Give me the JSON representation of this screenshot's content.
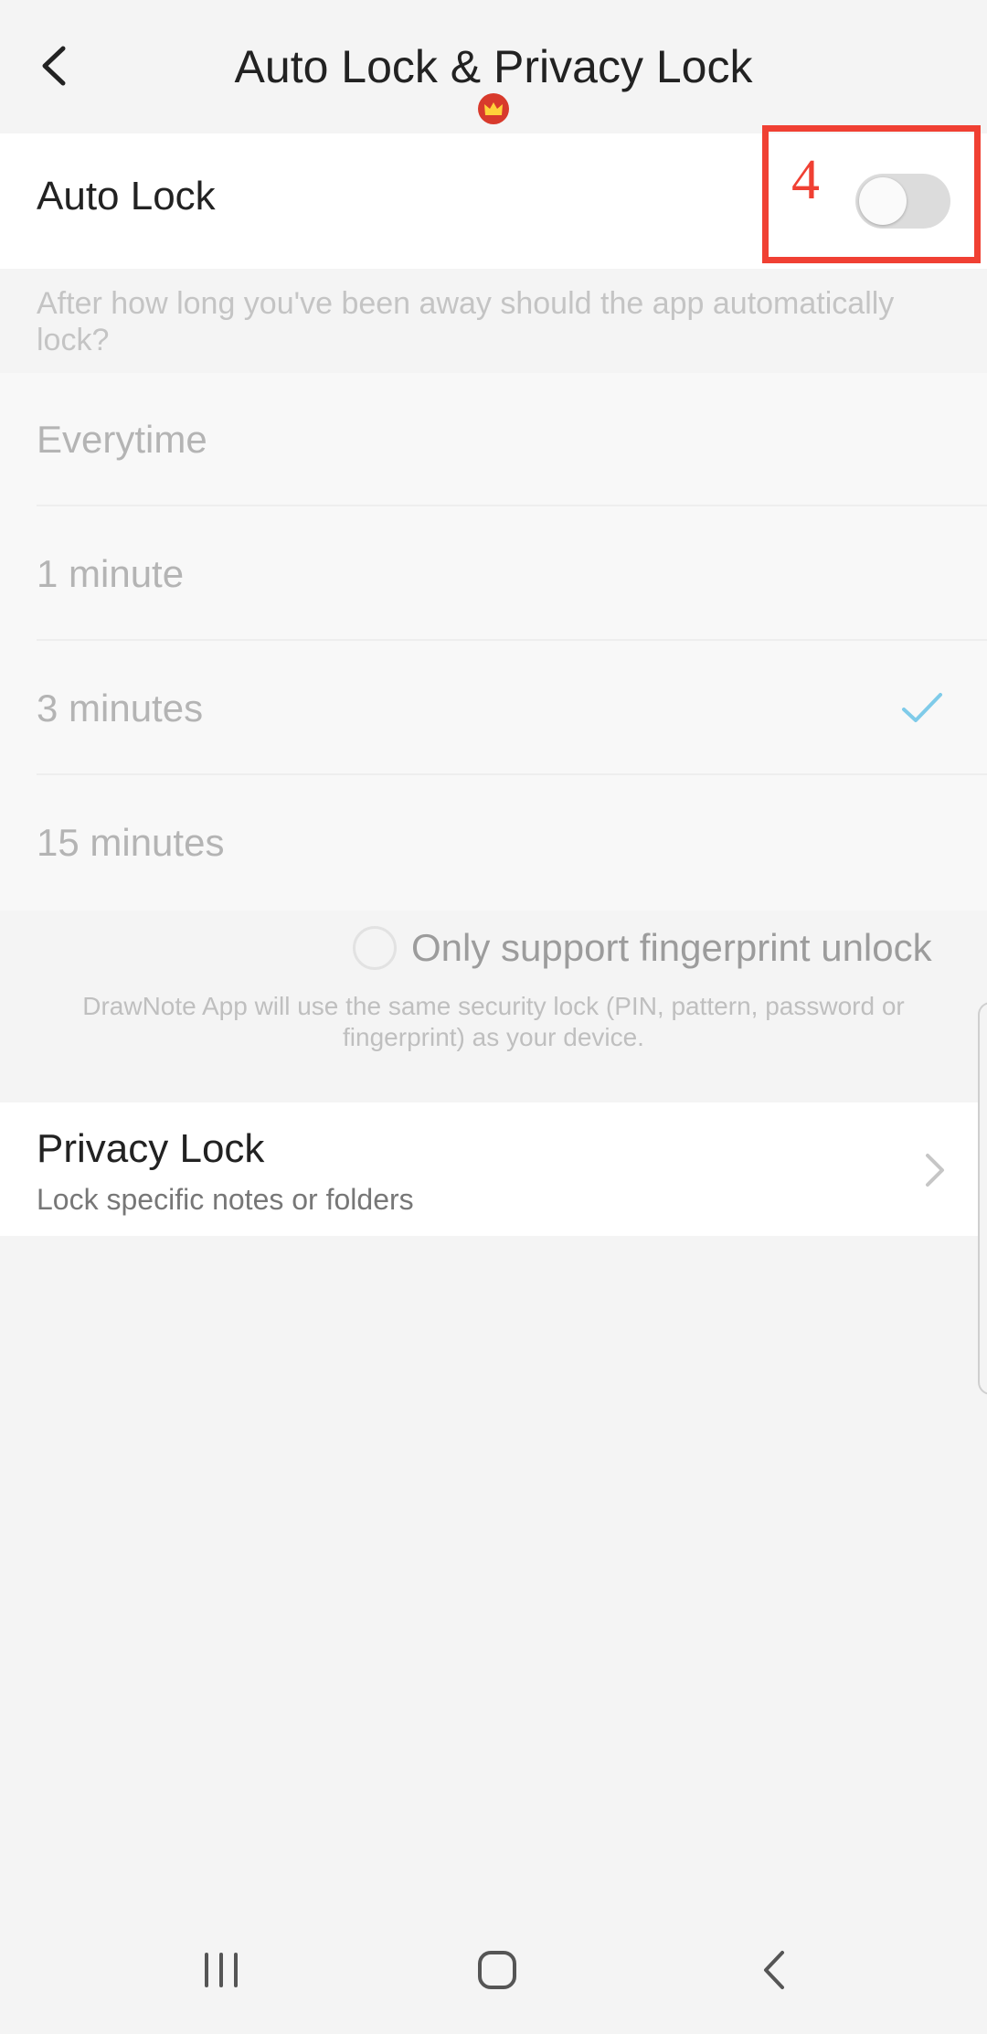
{
  "header": {
    "title": "Auto Lock & Privacy Lock",
    "back_icon": "chevron-left-icon",
    "badge_icon": "crown-icon",
    "badge_color": "#d83a2c"
  },
  "auto_lock": {
    "label": "Auto Lock",
    "toggle_on": false
  },
  "annotation": {
    "number": "4",
    "color": "#f04033"
  },
  "hint": "After how long you've been away should the app automatically lock?",
  "options": [
    {
      "label": "Everytime",
      "selected": false
    },
    {
      "label": "1 minute",
      "selected": false
    },
    {
      "label": "3 minutes",
      "selected": true
    },
    {
      "label": "15 minutes",
      "selected": false
    }
  ],
  "check_color": "#7fcbe9",
  "fingerprint": {
    "label": "Only support fingerprint unlock",
    "checked": false,
    "note": "DrawNote App will use the same security lock (PIN, pattern, password or fingerprint) as your device."
  },
  "privacy_lock": {
    "title": "Privacy Lock",
    "subtitle": "Lock specific notes or folders",
    "chevron_icon": "chevron-right-icon"
  },
  "navbar": {
    "recent_icon": "recent-apps-icon",
    "home_icon": "home-icon",
    "back_icon": "back-icon"
  }
}
